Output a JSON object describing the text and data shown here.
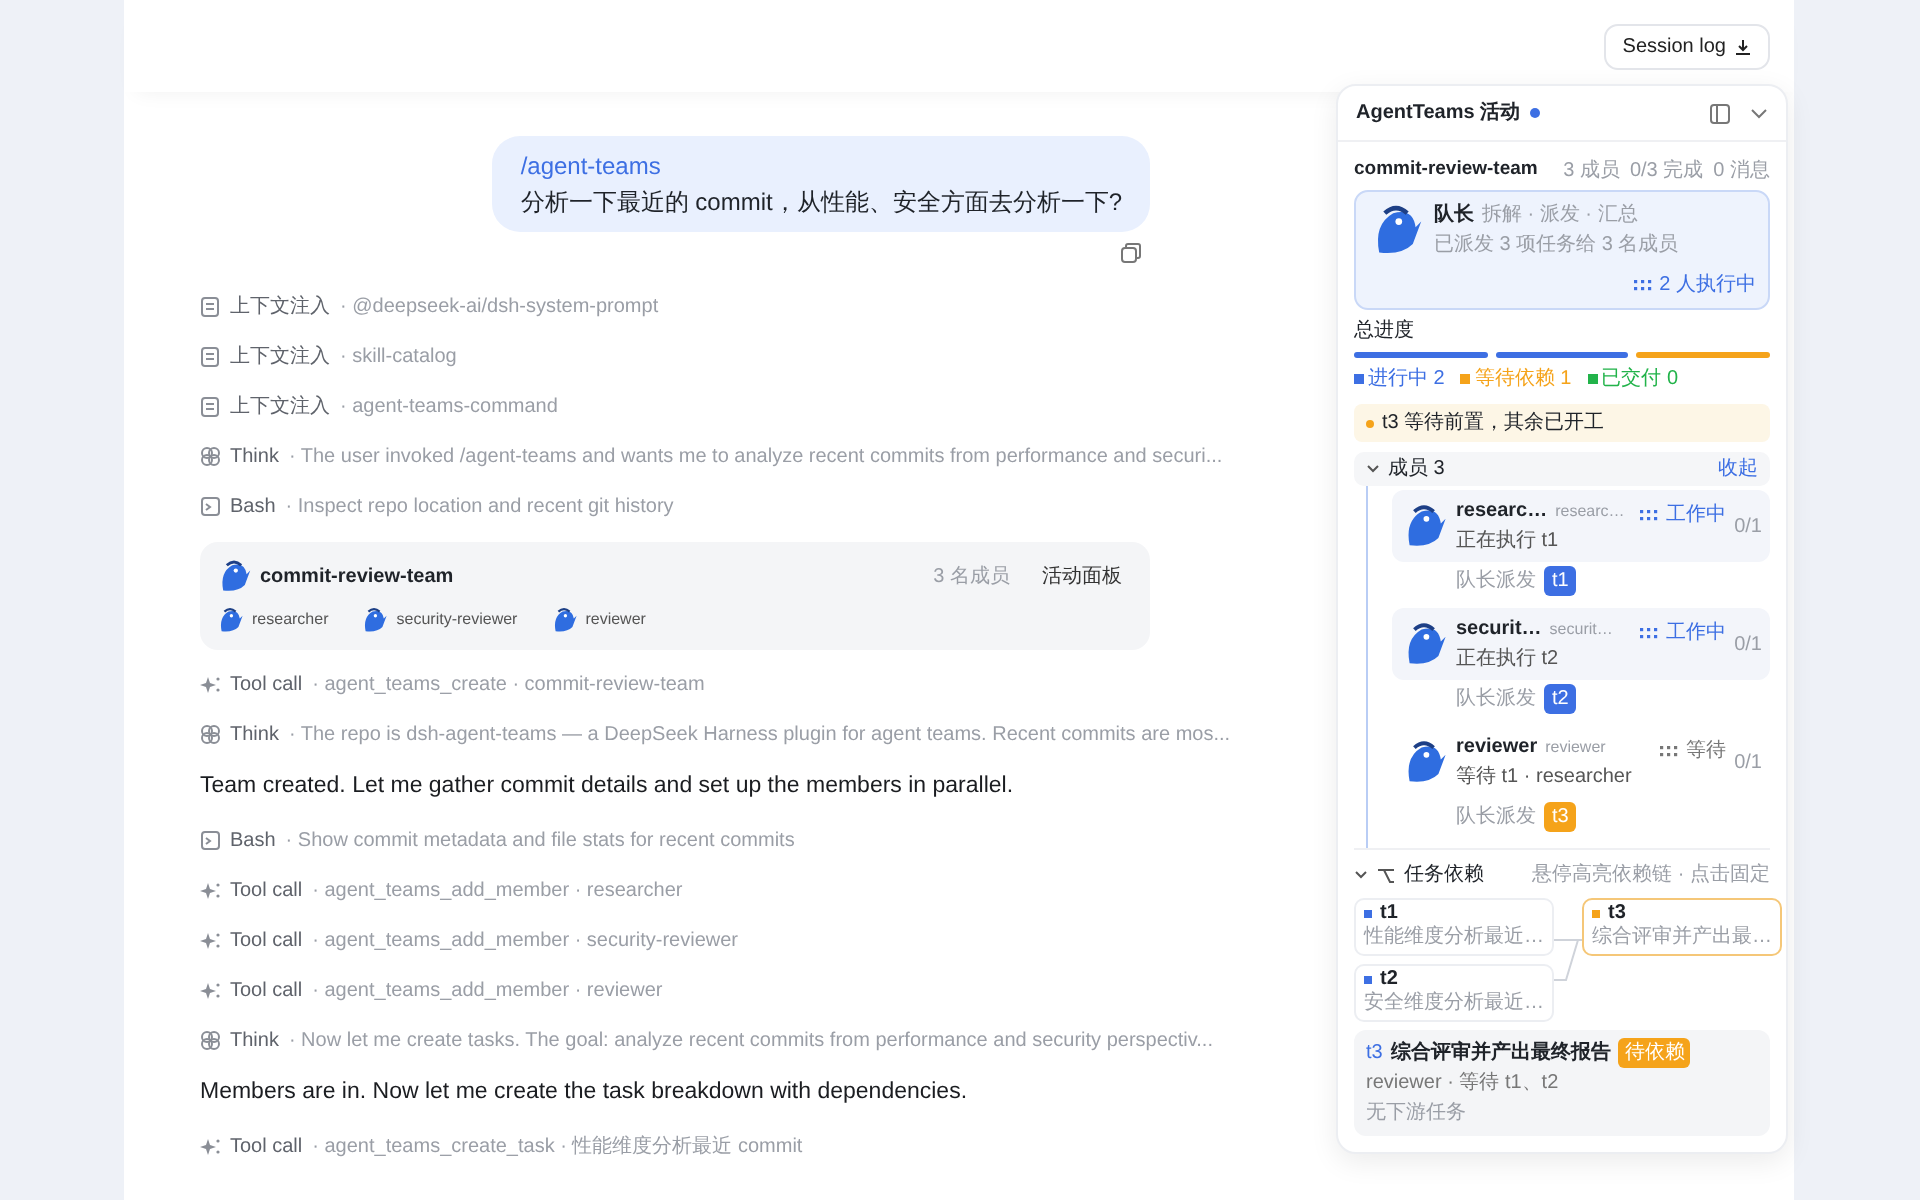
{
  "header": {
    "session_button": "Session log"
  },
  "user_message": {
    "command": "/agent-teams",
    "text": "分析一下最近的 commit，从性能、安全方面去分析一下?"
  },
  "log": [
    {
      "kind": "context",
      "label": "上下文注入",
      "detail": "· @deepseek-ai/dsh-system-prompt"
    },
    {
      "kind": "context",
      "label": "上下文注入",
      "detail": "· skill-catalog"
    },
    {
      "kind": "context",
      "label": "上下文注入",
      "detail": "· agent-teams-command"
    },
    {
      "kind": "think",
      "label": "Think",
      "detail": "· The user invoked /agent-teams and wants me to analyze recent commits from performance and securi..."
    },
    {
      "kind": "bash",
      "label": "Bash",
      "detail": "· Inspect repo location and recent git history"
    },
    {
      "kind": "team_card",
      "title": "commit-review-team",
      "count": "3 名成员",
      "link": "活动面板",
      "members": [
        "researcher",
        "security-reviewer",
        "reviewer"
      ]
    },
    {
      "kind": "tool",
      "label": "Tool call",
      "detail": "· agent_teams_create · commit-review-team"
    },
    {
      "kind": "think",
      "label": "Think",
      "detail": "· The repo is dsh-agent-teams — a DeepSeek Harness plugin for agent teams. Recent commits are mos..."
    },
    {
      "kind": "message",
      "text": "Team created. Let me gather commit details and set up the members in parallel."
    },
    {
      "kind": "bash",
      "label": "Bash",
      "detail": "· Show commit metadata and file stats for recent commits"
    },
    {
      "kind": "tool",
      "label": "Tool call",
      "detail": "· agent_teams_add_member · researcher"
    },
    {
      "kind": "tool",
      "label": "Tool call",
      "detail": "· agent_teams_add_member · security-reviewer"
    },
    {
      "kind": "tool",
      "label": "Tool call",
      "detail": "· agent_teams_add_member · reviewer"
    },
    {
      "kind": "think",
      "label": "Think",
      "detail": "· Now let me create tasks. The goal: analyze recent commits from performance and security perspectiv..."
    },
    {
      "kind": "message",
      "text": "Members are in. Now let me create the task breakdown with dependencies."
    },
    {
      "kind": "tool",
      "label": "Tool call",
      "detail": "· agent_teams_create_task · 性能维度分析最近 commit"
    }
  ],
  "panel": {
    "title": "AgentTeams 活动",
    "team": {
      "name": "commit-review-team",
      "stats": [
        "3 成员",
        "0/3 完成",
        "0 消息"
      ]
    },
    "lead": {
      "title": "队长",
      "subtitle": "拆解 · 派发 · 汇总",
      "summary": "已派发 3 项任务给 3 名成员",
      "status": "2 人执行中"
    },
    "progress": {
      "label": "总进度",
      "segments": [
        {
          "color": "#3d6fe3"
        },
        {
          "color": "#3d6fe3"
        },
        {
          "color": "#f5a31a"
        }
      ],
      "legend": [
        {
          "label": "进行中 2",
          "color": "#3d6fe3"
        },
        {
          "label": "等待依赖 1",
          "color": "#f5a31a"
        },
        {
          "label": "已交付 0",
          "color": "#22b34a"
        }
      ]
    },
    "notice": "t3 等待前置，其余已开工",
    "members_section": {
      "title": "成员 3",
      "expanded": true,
      "toggle": "收起",
      "members": [
        {
          "name": "researc…",
          "role": "researc…",
          "status": "工作中",
          "active": true,
          "count": "0/1",
          "activity": "正在执行 t1",
          "assigned_by": "队长派发",
          "task": "t1",
          "color": "#3d6fe3",
          "highlighted": true
        },
        {
          "name": "securit…",
          "role": "securit…",
          "status": "工作中",
          "active": true,
          "count": "0/1",
          "activity": "正在执行 t2",
          "assigned_by": "队长派发",
          "task": "t2",
          "color": "#3d6fe3",
          "highlighted": true
        },
        {
          "name": "reviewer",
          "role": "reviewer",
          "status": "等待",
          "active": false,
          "count": "0/1",
          "activity": "等待 t1 · researcher",
          "assigned_by": "队长派发",
          "task": "t3",
          "color": "#f5a31a",
          "highlighted": false
        }
      ]
    },
    "dependencies": {
      "title": "任务依赖",
      "hint": "悬停高亮依赖链 · 点击固定",
      "expanded": true,
      "nodes": [
        {
          "id": "t1",
          "desc": "性能维度分析最近…",
          "color": "#3d6fe3",
          "selected": false
        },
        {
          "id": "t2",
          "desc": "安全维度分析最近…",
          "color": "#3d6fe3",
          "selected": false
        },
        {
          "id": "t3",
          "desc": "综合评审并产出最…",
          "color": "#f5a31a",
          "selected": true
        }
      ],
      "detail": {
        "id": "t3",
        "title": "综合评审并产出最终报告",
        "badge": "待依赖",
        "meta": "reviewer · 等待 t1、t2",
        "downstream": "无下游任务"
      }
    }
  }
}
